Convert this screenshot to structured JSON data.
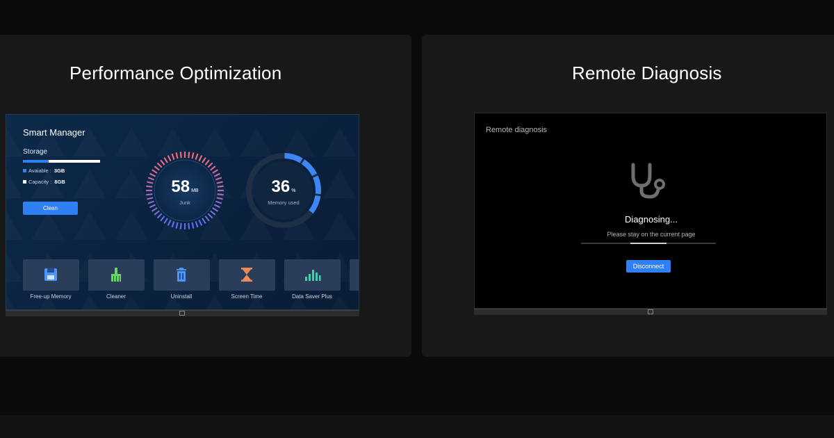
{
  "left_panel": {
    "title": "Performance Optimization",
    "smart_manager": {
      "title": "Smart Manager",
      "storage_label": "Storage",
      "storage_used_fraction": 0.33,
      "available_label": "Avaiable :",
      "available_value": "3GB",
      "capacity_label": "Capacity :",
      "capacity_value": "8GB",
      "clean_button": "Clean",
      "junk_gauge": {
        "value": "58",
        "unit": "MB",
        "label": "Junk"
      },
      "memory_gauge": {
        "value": "36",
        "unit": "%",
        "label": "Memory used",
        "percent": 36
      },
      "tiles": [
        {
          "label": "Free-up Memory",
          "icon": "floppy-disk-icon"
        },
        {
          "label": "Cleaner",
          "icon": "broom-icon"
        },
        {
          "label": "Uninstall",
          "icon": "trash-icon"
        },
        {
          "label": "Screen Time",
          "icon": "hourglass-icon"
        },
        {
          "label": "Data Saver Plus",
          "icon": "bar-chart-icon"
        }
      ]
    }
  },
  "right_panel": {
    "title": "Remote Diagnosis",
    "screen_title": "Remote diagnosis",
    "status": "Diagnosing...",
    "substatus": "Please stay on the current page",
    "progress_fraction": 0.27,
    "disconnect_button": "Disconnect",
    "icon": "stethoscope-icon"
  },
  "colors": {
    "accent": "#2f7ff5",
    "junk_gradient_start": "#f06a7a",
    "junk_gradient_end": "#5b6cf0",
    "memory_arc": "#3f86f5"
  }
}
